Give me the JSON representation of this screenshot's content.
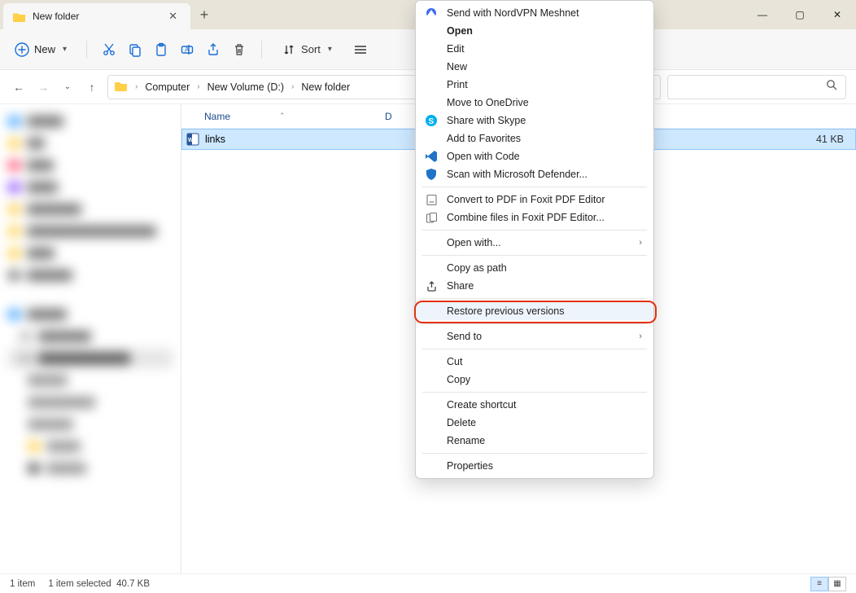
{
  "window": {
    "tab_title": "New folder",
    "minimize": "—",
    "maximize": "▢",
    "close": "✕",
    "add_tab": "+",
    "tab_close": "✕"
  },
  "toolbar": {
    "new_label": "New",
    "sort_label": "Sort"
  },
  "address": {
    "crumbs": [
      "Computer",
      "New Volume (D:)",
      "New folder"
    ]
  },
  "columns": {
    "name": "Name",
    "date": "D"
  },
  "file_row": {
    "name": "links",
    "size": "41 KB"
  },
  "status": {
    "count": "1 item",
    "selection": "1 item selected",
    "sel_size": "40.7 KB"
  },
  "context_menu": {
    "items": [
      {
        "label": "Send with NordVPN Meshnet",
        "icon": "nordvpn",
        "color": "#3f6df2"
      },
      {
        "label": "Open",
        "bold": true
      },
      {
        "label": "Edit"
      },
      {
        "label": "New"
      },
      {
        "label": "Print"
      },
      {
        "label": "Move to OneDrive"
      },
      {
        "label": "Share with Skype",
        "icon": "skype",
        "color": "#00aff0"
      },
      {
        "label": "Add to Favorites"
      },
      {
        "label": "Open with Code",
        "icon": "vscode",
        "color": "#1f74c7"
      },
      {
        "label": "Scan with Microsoft Defender...",
        "icon": "defender",
        "color": "#1f74c7"
      },
      {
        "sep": true
      },
      {
        "label": "Convert to PDF in Foxit PDF Editor",
        "icon": "pdf",
        "color": "#777"
      },
      {
        "label": "Combine files in Foxit PDF Editor...",
        "icon": "combine",
        "color": "#777"
      },
      {
        "sep": true
      },
      {
        "label": "Open with...",
        "sub": true
      },
      {
        "sep": true
      },
      {
        "label": "Copy as path"
      },
      {
        "label": "Share",
        "icon": "share",
        "color": "#444"
      },
      {
        "sep": true
      },
      {
        "label": "Restore previous versions",
        "highlight": true,
        "hover": true
      },
      {
        "sep": true
      },
      {
        "label": "Send to",
        "sub": true
      },
      {
        "sep": true
      },
      {
        "label": "Cut"
      },
      {
        "label": "Copy"
      },
      {
        "sep": true
      },
      {
        "label": "Create shortcut"
      },
      {
        "label": "Delete"
      },
      {
        "label": "Rename"
      },
      {
        "sep": true
      },
      {
        "label": "Properties"
      }
    ]
  }
}
